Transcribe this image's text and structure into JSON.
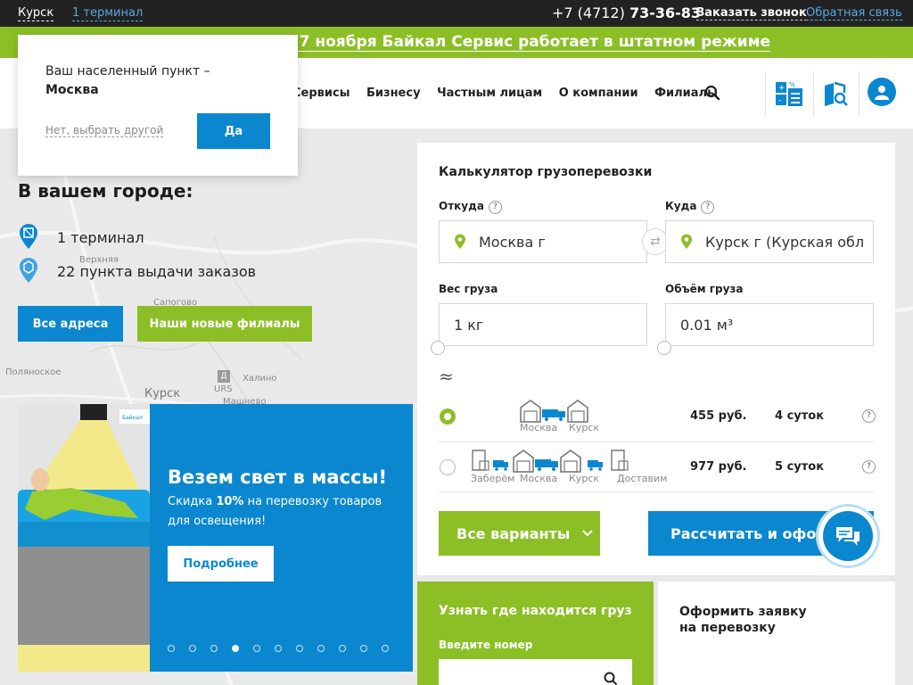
{
  "topbar": {
    "city": "Курск",
    "terminal": "1 терминал",
    "phone_prefix": "+7 (4712)",
    "phone_number": "73-36-83",
    "callback": "Заказать звонок",
    "feedback": "Обратная связь"
  },
  "announcement": "о 7 ноября Байкал Сервис работает в штатном режиме",
  "nav": [
    "Сервисы",
    "Бизнесу",
    "Частным лицам",
    "О компании",
    "Филиалы"
  ],
  "popup": {
    "question": "Ваш населенный пункт –",
    "city": "Москва",
    "no_label": "Нет, выбрать другой",
    "yes_label": "Да"
  },
  "city_block": {
    "title": "В вашем городе:",
    "terminals": "1 терминал",
    "pickup_points": "22 пункта выдачи заказов",
    "all_addresses": "Все адреса",
    "new_branches": "Наши новые филиалы"
  },
  "map_labels": [
    "Верхняя",
    "Сапогово",
    "Поляноское",
    "Курск",
    "Халино",
    "URS",
    "Машнево"
  ],
  "promo": {
    "title": "Везем свет в массы!",
    "subtitle_pre": "Скидка ",
    "subtitle_bold": "10%",
    "subtitle_post": " на перевозку товаров для освещения!",
    "more": "Подробнее",
    "slide_count": 11,
    "active_slide": 4
  },
  "calculator": {
    "title": "Калькулятор грузоперевозки",
    "from_label": "Откуда",
    "to_label": "Куда",
    "from_value": "Москва г",
    "to_value": "Курск г (Курская обл",
    "weight_label": "Вес груза",
    "volume_label": "Объём груза",
    "weight_value": "1 кг",
    "volume_value": "0.01 м³",
    "help": "?",
    "approx_symbol": "≈",
    "options": [
      {
        "selected": true,
        "stages": [
          "Москва",
          "Курск"
        ],
        "price": "455 руб.",
        "days": "4 суток"
      },
      {
        "selected": false,
        "stages": [
          "Заберём",
          "Москва",
          "Курск",
          "Доставим"
        ],
        "price": "977 руб.",
        "days": "5 суток"
      }
    ],
    "all_variants": "Все варианты",
    "calculate": "Рассчитать и оформить"
  },
  "track": {
    "title": "Узнать где находится груз",
    "input_label": "Введите номер"
  },
  "order": {
    "title": "Оформить заявку на перевозку"
  },
  "colors": {
    "green": "#8cbf26",
    "blue": "#0a87cf",
    "dark": "#222222"
  }
}
